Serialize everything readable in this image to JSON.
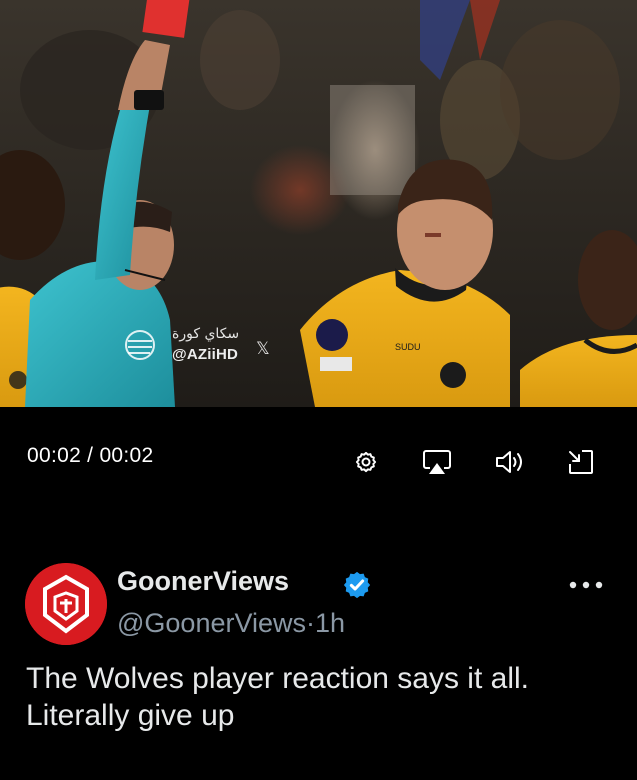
{
  "video": {
    "watermark_arabic": "سكاي كورة",
    "watermark_handle": "@AZiiHD",
    "watermark_x": "𝕏"
  },
  "player": {
    "time_label": "00:02 / 00:02",
    "icons": [
      "settings-icon",
      "airplay-icon",
      "volume-icon",
      "minimize-icon"
    ]
  },
  "post": {
    "display_name": "GoonerViews",
    "handle": "@GoonerViews",
    "separator": "·",
    "time_ago": "1h",
    "text": "The Wolves player reaction says it all. Literally give up",
    "verified_color": "#1d9bf0",
    "avatar_color": "#d81b20"
  }
}
